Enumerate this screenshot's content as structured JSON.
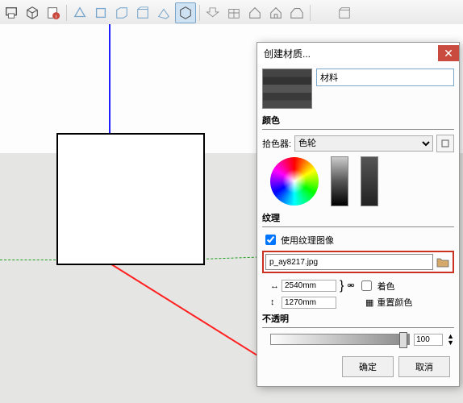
{
  "toolbar": {
    "icons": [
      "component",
      "layers",
      "info",
      "shape1",
      "shape2",
      "shape3",
      "shape4",
      "shape5",
      "shape6",
      "unfold",
      "package",
      "house1",
      "house2",
      "cube",
      "empty",
      "box"
    ]
  },
  "dialog": {
    "title": "创建材质...",
    "material_name": "材料",
    "color_section": "颜色",
    "picker_label": "拾色器:",
    "picker_value": "色轮",
    "texture_section": "纹理",
    "use_texture_image": "使用纹理图像",
    "texture_filename": "p_ay8217.jpg",
    "width_value": "2540mm",
    "height_value": "1270mm",
    "colorize": "着色",
    "reset_color": "重置颜色",
    "opacity_section": "不透明",
    "opacity_value": "100",
    "ok": "确定",
    "cancel": "取消"
  }
}
